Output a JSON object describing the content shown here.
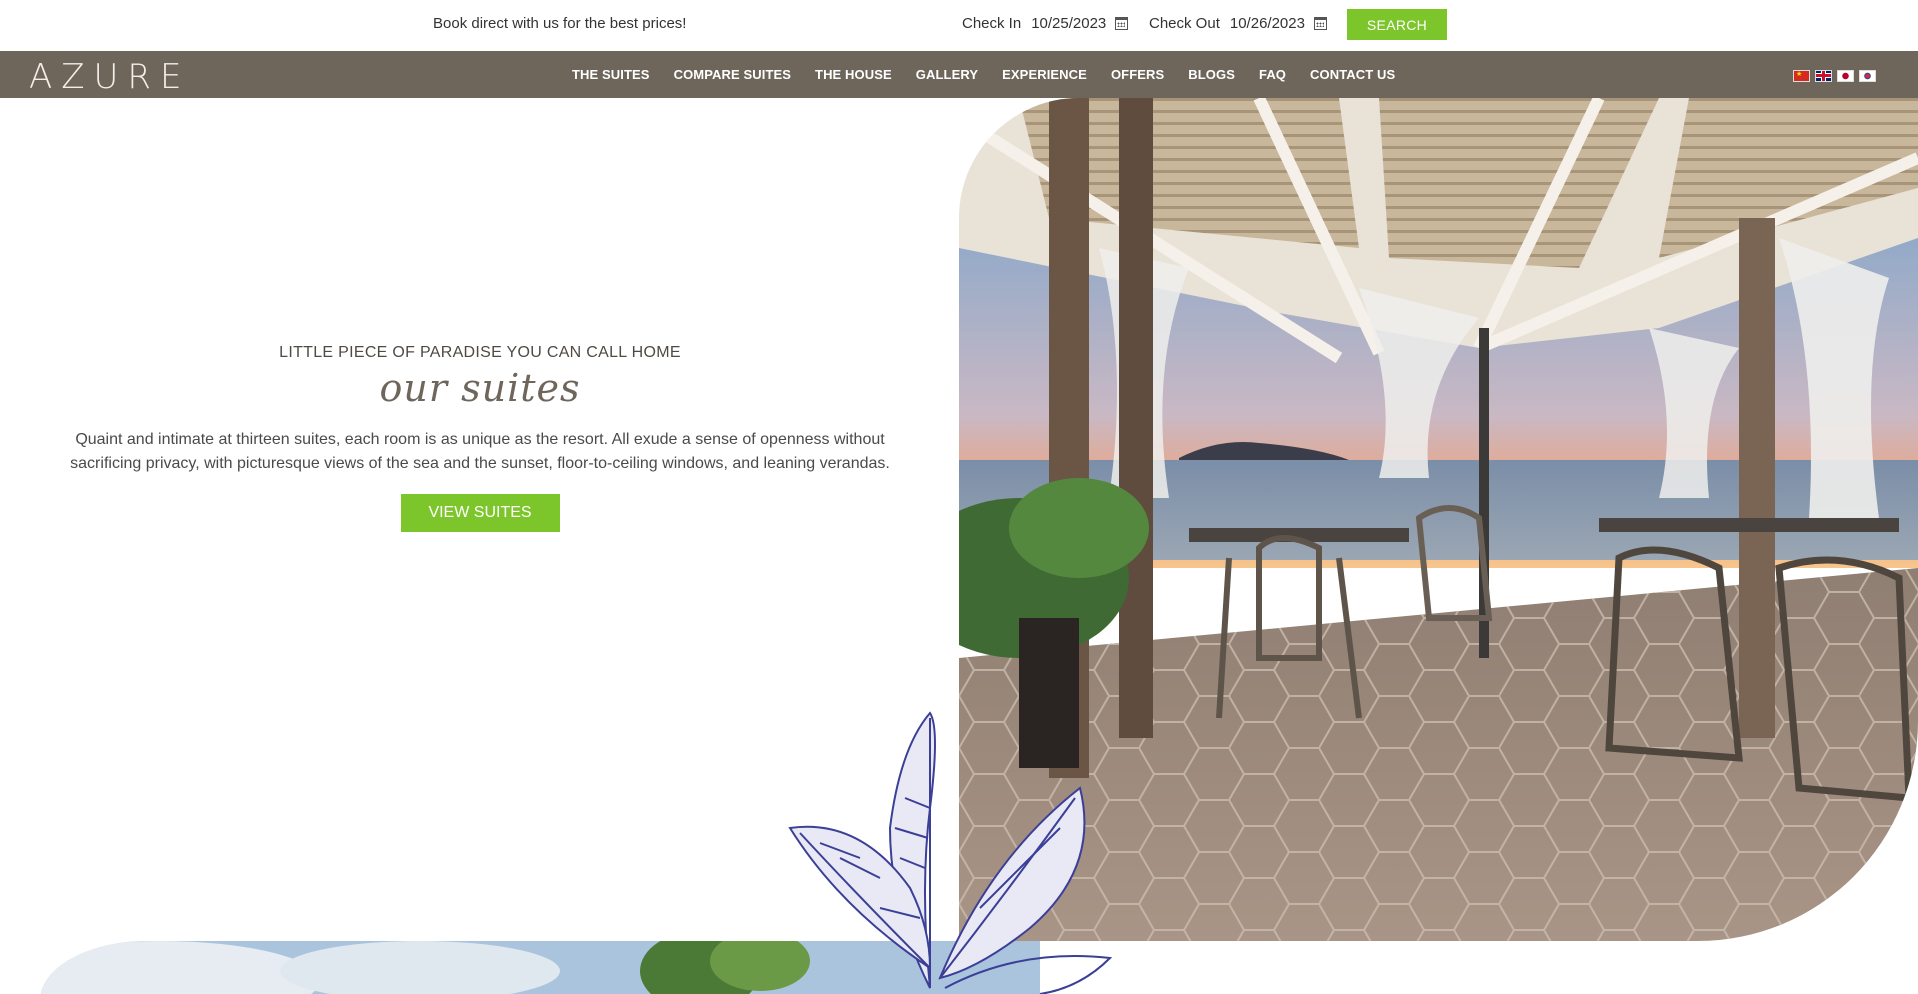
{
  "booking": {
    "tagline": "Book direct with us for the best prices!",
    "checkin_label": "Check In",
    "checkin_value": "10/25/2023",
    "checkout_label": "Check Out",
    "checkout_value": "10/26/2023",
    "search_label": "SEARCH",
    "icons": [
      "calendar-icon",
      "calendar-icon"
    ]
  },
  "nav": {
    "logo": "AZURE",
    "items": [
      {
        "label": "THE SUITES"
      },
      {
        "label": "COMPARE SUITES"
      },
      {
        "label": "THE HOUSE"
      },
      {
        "label": "GALLERY"
      },
      {
        "label": "EXPERIENCE"
      },
      {
        "label": "OFFERS"
      },
      {
        "label": "BLOGS"
      },
      {
        "label": "FAQ"
      },
      {
        "label": "CONTACT US"
      }
    ],
    "languages": [
      "flag-china-icon",
      "flag-uk-icon",
      "flag-japan-icon",
      "flag-korea-icon"
    ]
  },
  "hero": {
    "eyebrow": "LITTLE PIECE OF PARADISE YOU CAN CALL HOME",
    "title": "our suites",
    "description": "Quaint and intimate at thirteen suites, each room is as unique as the resort. All exude a sense of openness without sacrificing privacy, with picturesque views of the sea and the sunset, floor-to-ceiling windows, and leaning verandas.",
    "cta_label": "VIEW SUITES"
  },
  "colors": {
    "accent": "#7cc62b",
    "nav_bg": "#6e665b",
    "leaf": "#3b3f96"
  }
}
